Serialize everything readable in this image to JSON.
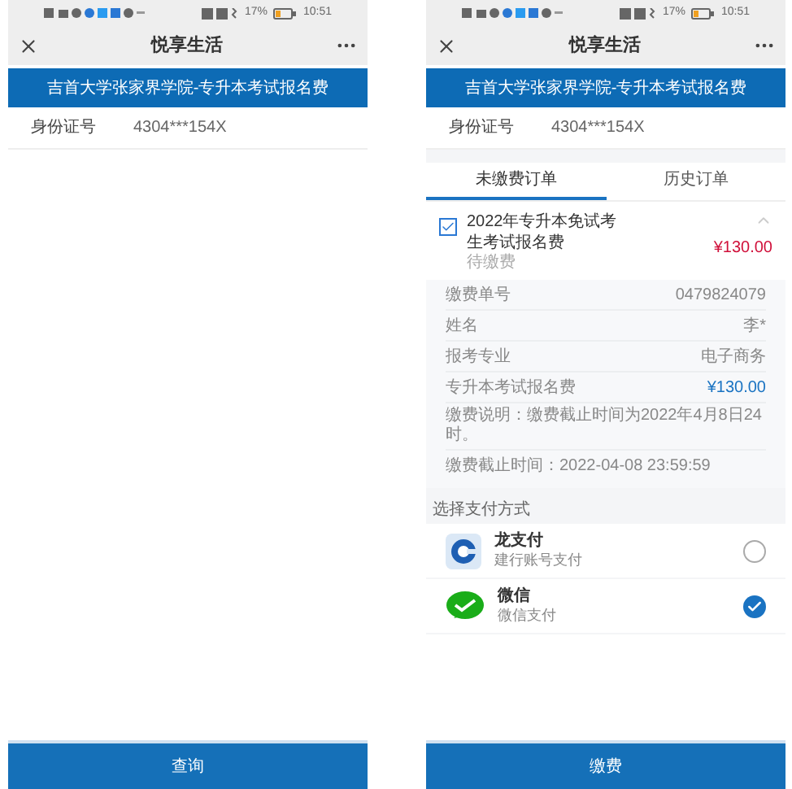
{
  "screens": [
    {
      "status_bar": {
        "battery": "17%",
        "time": "10:51"
      },
      "nav": {
        "title": "悦享生活"
      },
      "banner": "吉首大学张家界学院-专升本考试报名费",
      "id_row": {
        "label": "身份证号",
        "value": "4304***154X"
      },
      "action_button": "查询"
    },
    {
      "status_bar": {
        "battery": "17%",
        "time": "10:51"
      },
      "nav": {
        "title": "悦享生活"
      },
      "banner": "吉首大学张家界学院-专升本考试报名费",
      "id_row": {
        "label": "身份证号",
        "value": "4304***154X"
      },
      "tabs": [
        {
          "label": "未缴费订单",
          "selected": true
        },
        {
          "label": "历史订单",
          "selected": false
        }
      ],
      "order": {
        "checked": true,
        "expanded": true,
        "title": "2022年专升本免试考生考试报名费",
        "status": "待缴费",
        "amount": "¥130.00",
        "details": [
          {
            "kind": "pair",
            "label": "缴费单号",
            "value": "0479824079"
          },
          {
            "kind": "pair",
            "label": "姓名",
            "value": "李*"
          },
          {
            "kind": "pair",
            "label": "报考专业",
            "value": "电子商务"
          },
          {
            "kind": "amount",
            "label": "专升本考试报名费",
            "value": "¥130.00"
          },
          {
            "kind": "note",
            "text": "缴费说明：缴费截止时间为2022年4月8日24时。"
          },
          {
            "kind": "note",
            "text": "缴费截止时间：2022-04-08 23:59:59"
          }
        ]
      },
      "payment": {
        "label": "选择支付方式",
        "methods": [
          {
            "kind": "ccb",
            "name": "龙支付",
            "sub": "建行账号支付",
            "selected": false
          },
          {
            "kind": "wechat",
            "name": "微信",
            "sub": "微信支付",
            "selected": true
          }
        ]
      },
      "action_button": "缴费"
    }
  ]
}
